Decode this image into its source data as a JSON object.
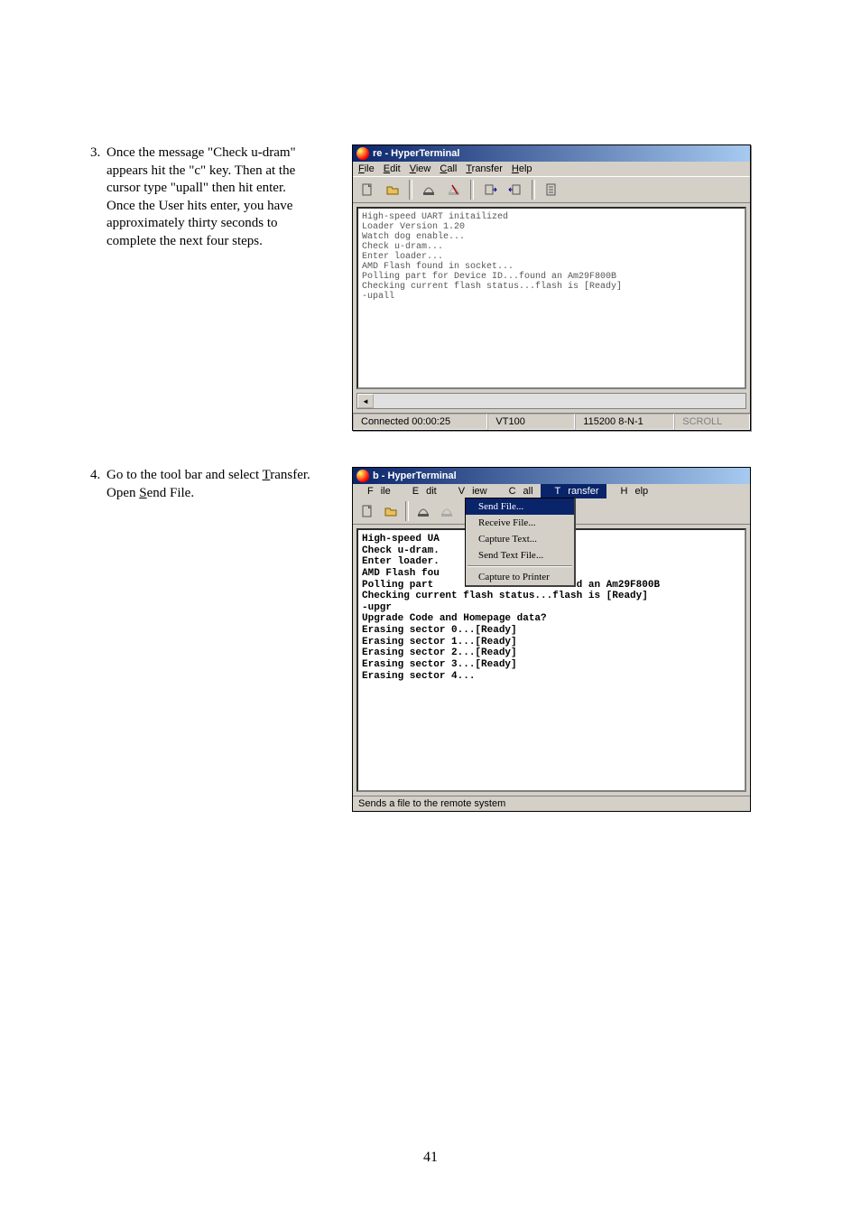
{
  "step3": {
    "num": "3.",
    "text_parts": [
      "Once the message \"Check u-dram\" appears hit the \"c\" key.  Then at the cursor type \"upall\" then hit enter.  Once the User hits enter, you have approximately thirty seconds to complete the next four steps."
    ]
  },
  "step4": {
    "num": "4.",
    "prefix": "Go to the tool bar and select ",
    "transfer": "T",
    "transfer_rest": "ransfer.  Open ",
    "send": "S",
    "send_rest": "end File."
  },
  "win1": {
    "title": "re - HyperTerminal",
    "menu": {
      "file": "File",
      "edit": "Edit",
      "view": "View",
      "call": "Call",
      "transfer": "Transfer",
      "help": "Help"
    },
    "terminal": "High-speed UART initailized\nLoader Version 1.20\nWatch dog enable...\nCheck u-dram...\nEnter loader...\nAMD Flash found in socket...\nPolling part for Device ID...found an Am29F800B\nChecking current flash status...flash is [Ready]\n-upall",
    "status": {
      "connected": "Connected 00:00:25",
      "emu": "VT100",
      "baud": "115200 8-N-1",
      "scroll": "SCROLL"
    }
  },
  "win2": {
    "title": "b - HyperTerminal",
    "menu": {
      "file": "File",
      "edit": "Edit",
      "view": "View",
      "call": "Call",
      "transfer": "Transfer",
      "help": "Help"
    },
    "dropdown": {
      "send_file": "Send File...",
      "receive_file": "Receive File...",
      "capture_text": "Capture Text...",
      "send_text_file": "Send Text File...",
      "capture_to_printer": "Capture to Printer"
    },
    "terminal": "High-speed UA\nCheck u-dram.\nEnter loader.\nAMD Flash fou\nPolling part                    found an Am29F800B\nChecking current flash status...flash is [Ready]\n-upgr\nUpgrade Code and Homepage data?\nErasing sector 0...[Ready]\nErasing sector 1...[Ready]\nErasing sector 2...[Ready]\nErasing sector 3...[Ready]\nErasing sector 4...",
    "status": "Sends a file to the remote system"
  },
  "pagenum": "41"
}
